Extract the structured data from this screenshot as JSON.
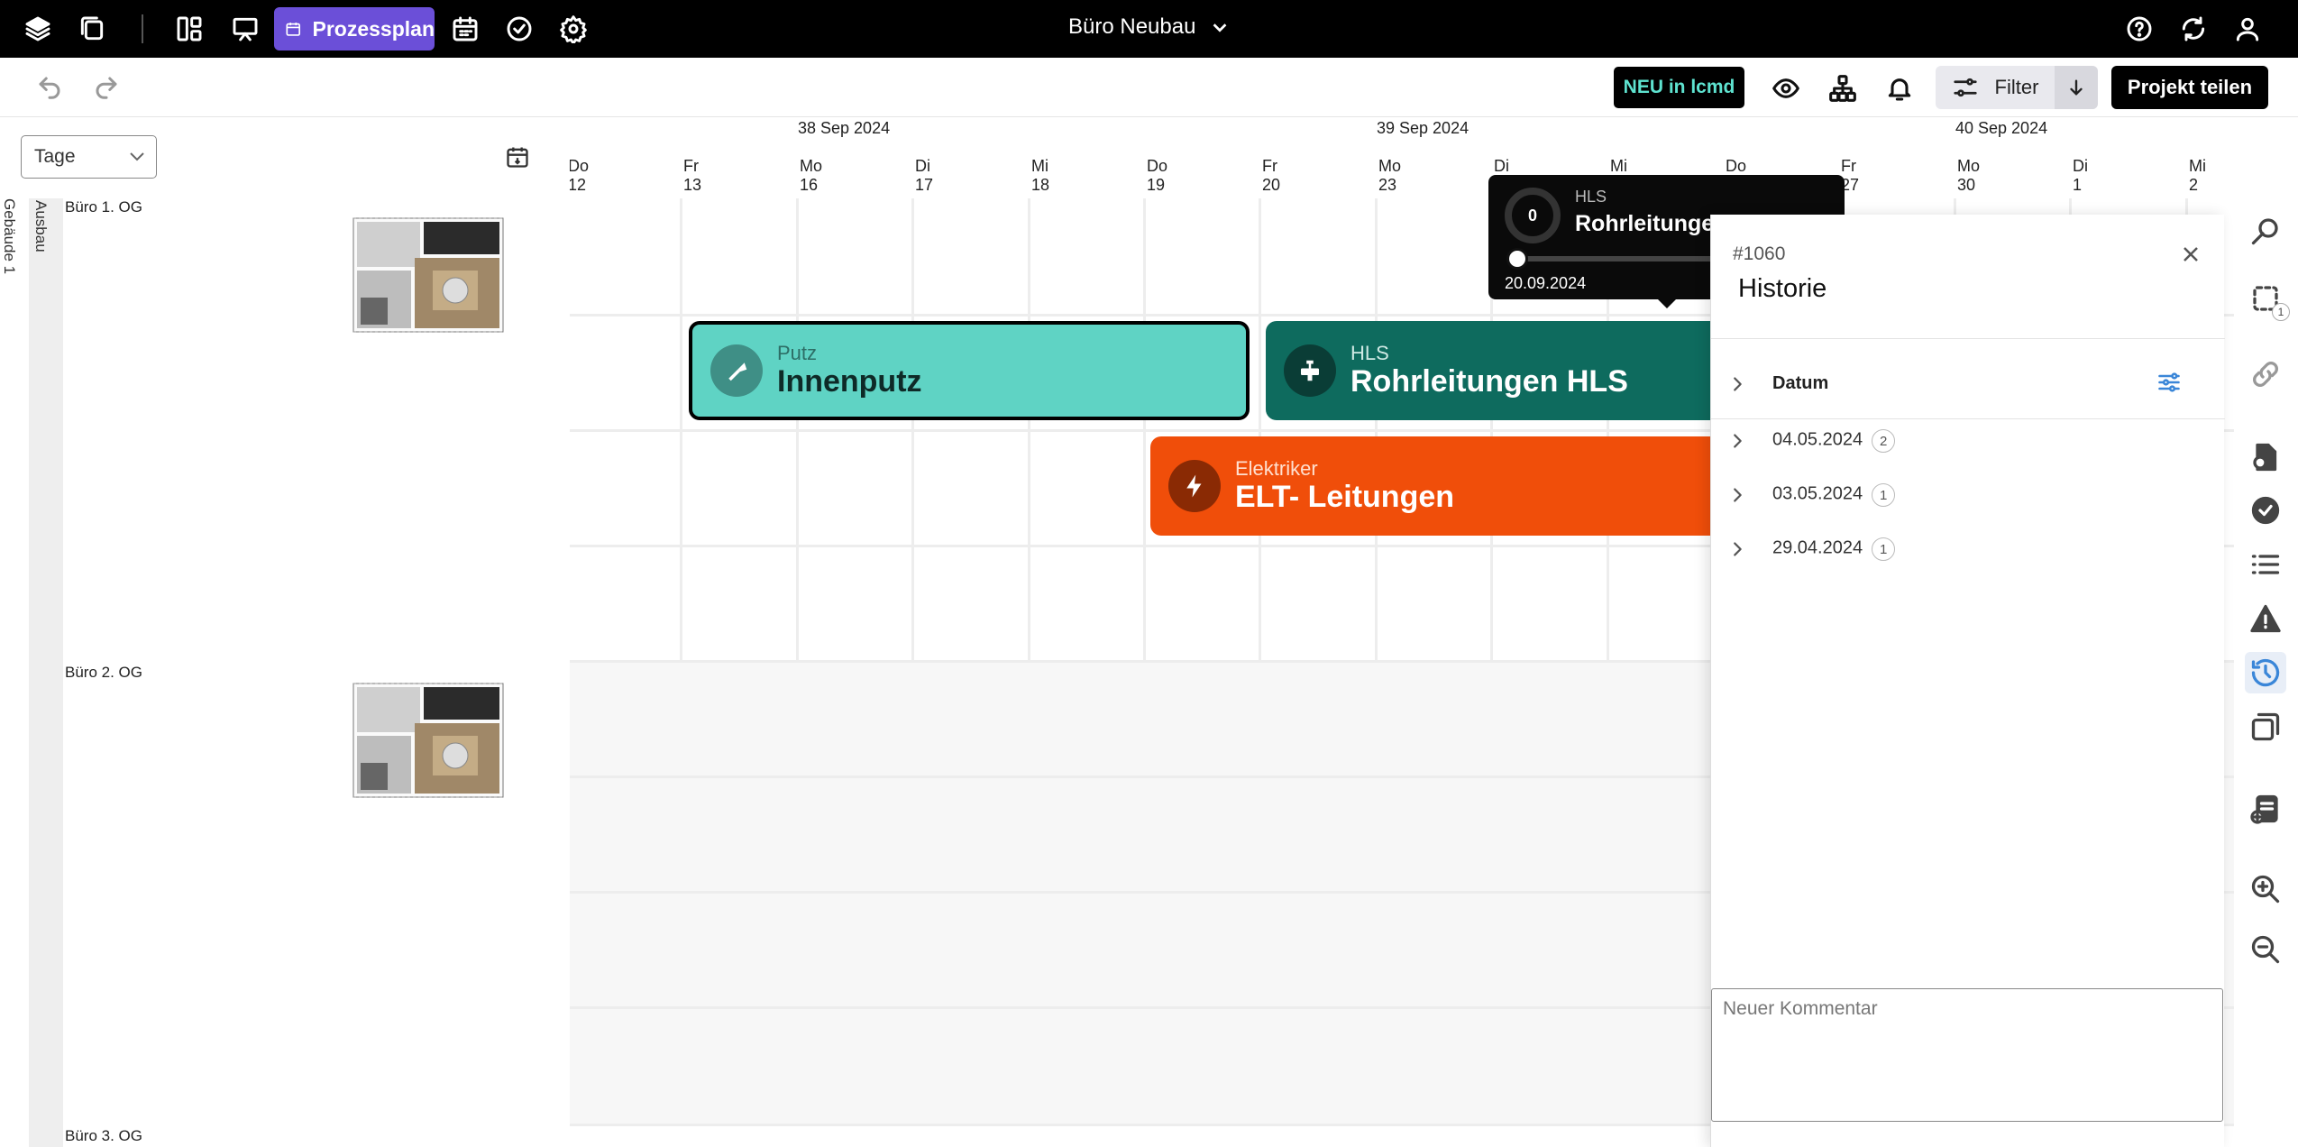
{
  "topbar": {
    "active_tab": "Prozessplan",
    "project_title": "Büro Neubau",
    "icons": [
      "layers-icon",
      "files-icon",
      "layout-icon",
      "presentation-icon",
      "calendar-icon",
      "check-circle-icon",
      "gear-icon",
      "help-icon",
      "refresh-icon",
      "user-icon"
    ]
  },
  "toolbar": {
    "neu_label": "NEU in lcmd",
    "filter_label": "Filter",
    "share_label": "Projekt teilen"
  },
  "left": {
    "view_select": "Tage",
    "building_label": "Gebäude 1",
    "section_label": "Ausbau",
    "rows": [
      "Büro 1. OG",
      "Büro 2. OG",
      "Büro 3. OG"
    ]
  },
  "timeline": {
    "weeks": [
      "38 Sep 2024",
      "39 Sep 2024",
      "40 Sep 2024"
    ],
    "days": [
      {
        "wd": "Do",
        "d": "12"
      },
      {
        "wd": "Fr",
        "d": "13"
      },
      {
        "wd": "Mo",
        "d": "16"
      },
      {
        "wd": "Di",
        "d": "17"
      },
      {
        "wd": "Mi",
        "d": "18"
      },
      {
        "wd": "Do",
        "d": "19"
      },
      {
        "wd": "Fr",
        "d": "20"
      },
      {
        "wd": "Mo",
        "d": "23"
      },
      {
        "wd": "Di",
        "d": ""
      },
      {
        "wd": "Mi",
        "d": ""
      },
      {
        "wd": "Do",
        "d": ""
      },
      {
        "wd": "Fr",
        "d": "27"
      },
      {
        "wd": "Mo",
        "d": "30"
      },
      {
        "wd": "Di",
        "d": "1"
      },
      {
        "wd": "Mi",
        "d": "2"
      }
    ]
  },
  "tasks": [
    {
      "trade": "Putz",
      "name": "Innenputz",
      "color": "#5fd3c4",
      "icon_bg": "#3f8f86",
      "text_color": "#0e2a27"
    },
    {
      "trade": "HLS",
      "name": "Rohrleitungen  HLS",
      "color": "#0e6b5e",
      "icon_bg": "#0a3d36",
      "text_color": "#ffffff"
    },
    {
      "trade": "Elektriker",
      "name": "ELT- Leitungen",
      "color": "#f04e0a",
      "icon_bg": "#8a2a04",
      "text_color": "#ffffff"
    }
  ],
  "tooltip": {
    "progress": "0",
    "trade": "HLS",
    "name": "Rohrleitungen HLS",
    "date": "20.09.2024"
  },
  "panel": {
    "id": "#1060",
    "title": "Historie",
    "header": "Datum",
    "entries": [
      {
        "date": "04.05.2024",
        "count": "2"
      },
      {
        "date": "03.05.2024",
        "count": "1"
      },
      {
        "date": "29.04.2024",
        "count": "1"
      }
    ],
    "comment_placeholder": "Neuer Kommentar"
  },
  "rightbar": {
    "selection_count": "1",
    "icons": [
      "search-icon",
      "selection-icon",
      "link-icon",
      "document-icon",
      "check-icon",
      "list-icon",
      "warning-icon",
      "history-icon",
      "layers-icon",
      "add-document-icon",
      "zoom-in-icon",
      "zoom-out-icon"
    ]
  }
}
